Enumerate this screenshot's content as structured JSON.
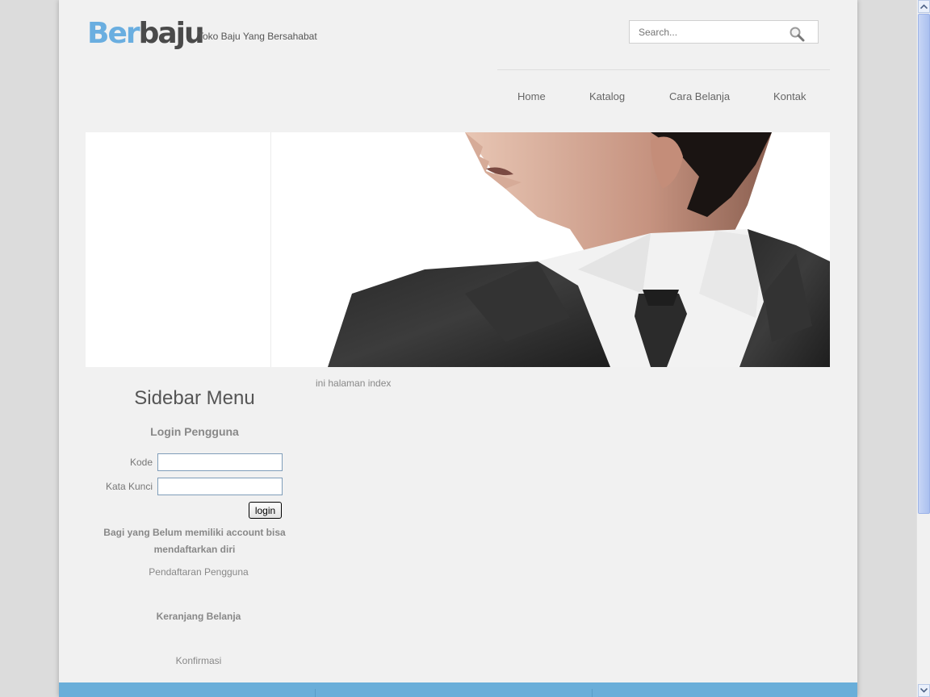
{
  "header": {
    "logo_part1": "Ber",
    "logo_part2": "baju",
    "tagline": "Toko Baju Yang Bersahabat",
    "search_placeholder": "Search..."
  },
  "nav": {
    "items": [
      {
        "label": "Home"
      },
      {
        "label": "Katalog"
      },
      {
        "label": "Cara Belanja"
      },
      {
        "label": "Kontak"
      }
    ]
  },
  "sidebar": {
    "title": "Sidebar Menu",
    "login_title": "Login Pengguna",
    "kode_label": "Kode",
    "kata_kunci_label": "Kata Kunci",
    "login_button": "login",
    "register_note": "Bagi yang Belum memiliki account bisa mendaftarkan diri",
    "register_link": "Pendaftaran Pengguna",
    "cart_link": "Keranjang Belanja",
    "confirm_link": "Konfirmasi"
  },
  "content": {
    "text": "ini halaman index"
  },
  "colors": {
    "logo_blue": "#6aaee0",
    "footer_blue": "#6aaed9"
  }
}
